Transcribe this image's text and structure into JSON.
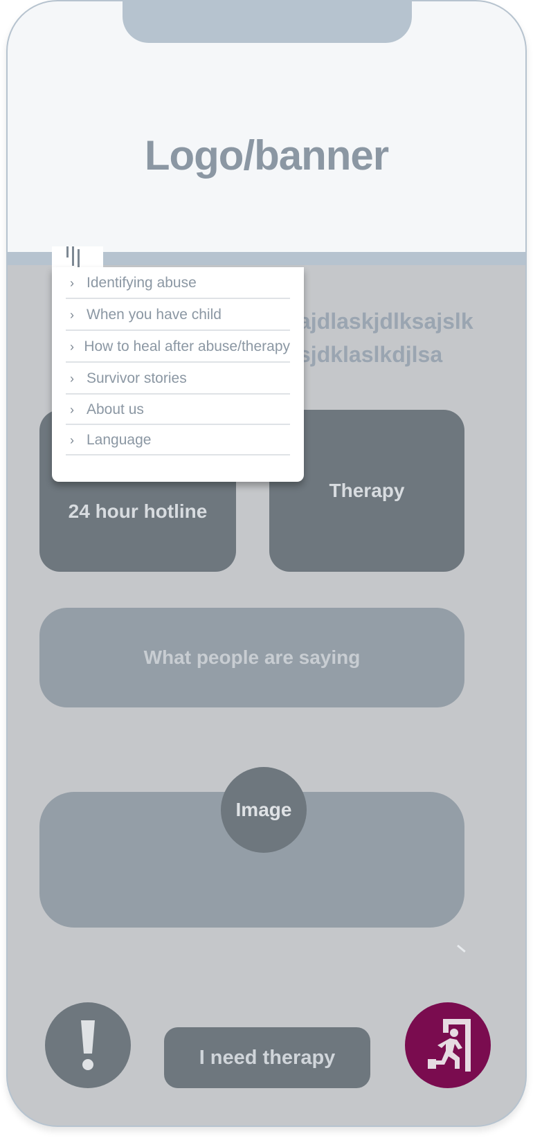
{
  "header": {
    "logo_text": "Logo/banner"
  },
  "menu": {
    "items": [
      {
        "label": "Identifying abuse",
        "icon": "chevron-right-icon"
      },
      {
        "label": "When you have child",
        "icon": "chevron-right-icon"
      },
      {
        "label": "How to heal after abuse/therapy",
        "icon": "chevron-right-icon"
      },
      {
        "label": "Survivor stories",
        "icon": "chevron-right-icon"
      },
      {
        "label": "About us",
        "icon": "chevron-right-icon"
      },
      {
        "label": "Language",
        "icon": "chevron-right-icon"
      }
    ]
  },
  "intro": {
    "line1": "ajdlaskjdlksajslk",
    "line2": "sjdklaslkdjlsa"
  },
  "tiles": {
    "hotline": "24 hour hotline",
    "therapy": "Therapy"
  },
  "testimonials": {
    "title": "What people are saying",
    "image_label": "Image"
  },
  "footer": {
    "alert_icon": "exclamation-icon",
    "therapy_button": "I need therapy",
    "exit_icon": "emergency-exit-icon"
  },
  "colors": {
    "header_bg": "#f5f7f9",
    "accent_bar": "#b6c3cf",
    "body_bg": "#c5c7ca",
    "tile": "#6e777e",
    "card": "#949ea7",
    "exit_button": "#7a0c4f"
  }
}
